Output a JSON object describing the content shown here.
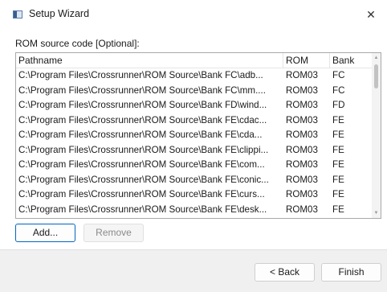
{
  "window": {
    "title": "Setup Wizard",
    "close_glyph": "✕"
  },
  "section_label": "ROM source code [Optional]:",
  "table": {
    "columns": [
      "Pathname",
      "ROM",
      "Bank"
    ],
    "rows": [
      {
        "path": "C:\\Program Files\\Crossrunner\\ROM Source\\Bank FC\\adb...",
        "rom": "ROM03",
        "bank": "FC"
      },
      {
        "path": "C:\\Program Files\\Crossrunner\\ROM Source\\Bank FC\\mm....",
        "rom": "ROM03",
        "bank": "FC"
      },
      {
        "path": "C:\\Program Files\\Crossrunner\\ROM Source\\Bank FD\\wind...",
        "rom": "ROM03",
        "bank": "FD"
      },
      {
        "path": "C:\\Program Files\\Crossrunner\\ROM Source\\Bank FE\\cdac...",
        "rom": "ROM03",
        "bank": "FE"
      },
      {
        "path": "C:\\Program Files\\Crossrunner\\ROM Source\\Bank FE\\cda...",
        "rom": "ROM03",
        "bank": "FE"
      },
      {
        "path": "C:\\Program Files\\Crossrunner\\ROM Source\\Bank FE\\clippi...",
        "rom": "ROM03",
        "bank": "FE"
      },
      {
        "path": "C:\\Program Files\\Crossrunner\\ROM Source\\Bank FE\\com...",
        "rom": "ROM03",
        "bank": "FE"
      },
      {
        "path": "C:\\Program Files\\Crossrunner\\ROM Source\\Bank FE\\conic...",
        "rom": "ROM03",
        "bank": "FE"
      },
      {
        "path": "C:\\Program Files\\Crossrunner\\ROM Source\\Bank FE\\curs...",
        "rom": "ROM03",
        "bank": "FE"
      },
      {
        "path": "C:\\Program Files\\Crossrunner\\ROM Source\\Bank FE\\desk...",
        "rom": "ROM03",
        "bank": "FE"
      }
    ]
  },
  "buttons": {
    "add": "Add...",
    "remove": "Remove",
    "back": "< Back",
    "finish": "Finish"
  },
  "scrollbar": {
    "up_glyph": "▲",
    "down_glyph": "▼"
  },
  "colors": {
    "accent": "#0067c0",
    "footer_bg": "#f0f0f0"
  }
}
